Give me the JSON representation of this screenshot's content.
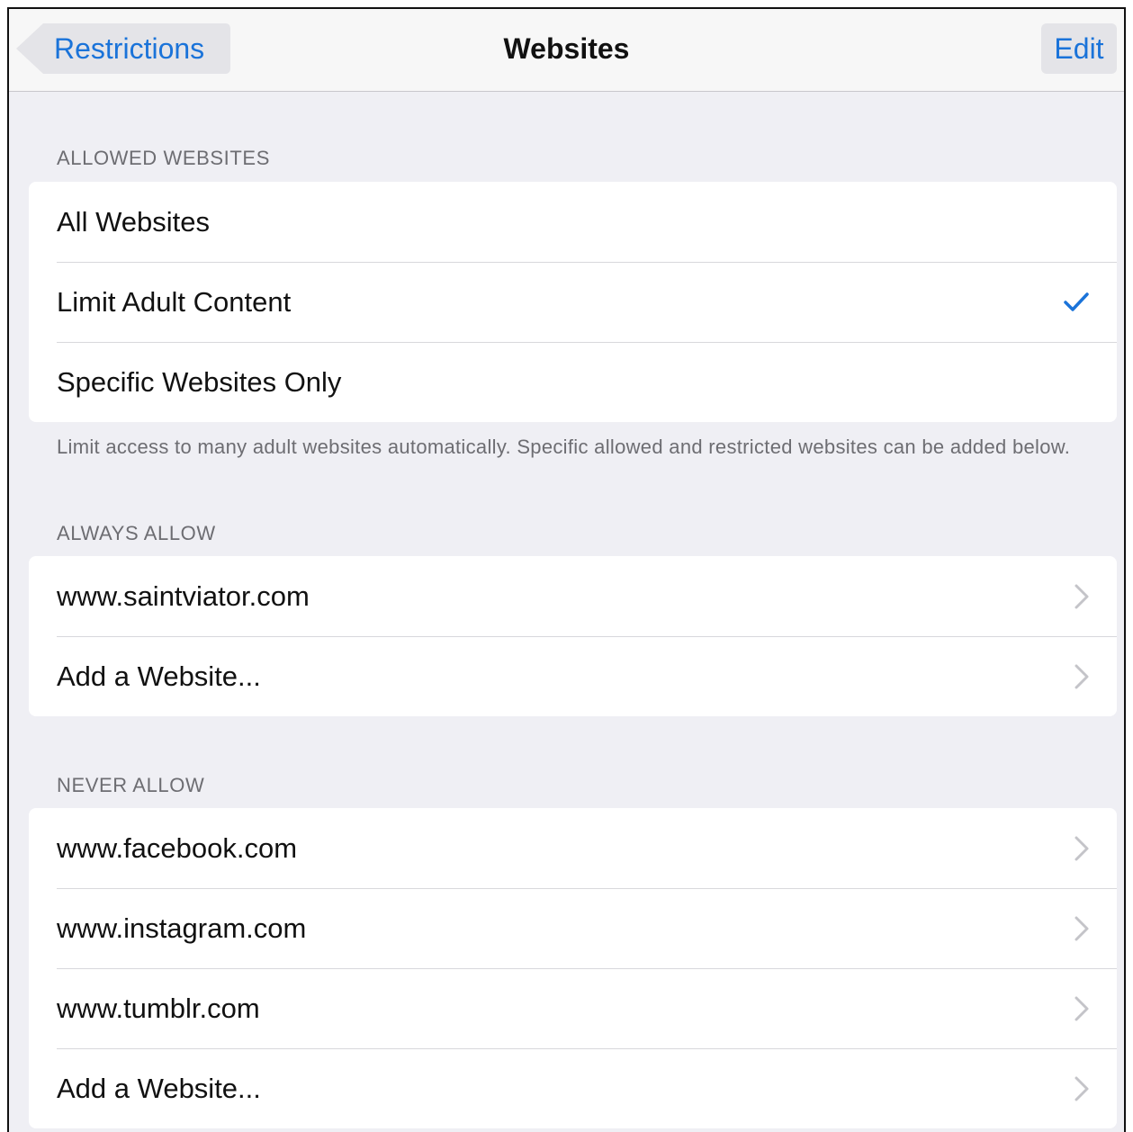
{
  "navbar": {
    "back_label": "Restrictions",
    "title": "Websites",
    "edit_label": "Edit"
  },
  "allowed_websites": {
    "header": "ALLOWED WEBSITES",
    "options": [
      {
        "label": "All Websites",
        "selected": false
      },
      {
        "label": "Limit Adult Content",
        "selected": true
      },
      {
        "label": "Specific Websites Only",
        "selected": false
      }
    ],
    "footer": "Limit access to many adult websites automatically. Specific allowed and restricted websites can be added below."
  },
  "always_allow": {
    "header": "ALWAYS ALLOW",
    "items": [
      {
        "label": "www.saintviator.com"
      },
      {
        "label": "Add a Website..."
      }
    ]
  },
  "never_allow": {
    "header": "NEVER ALLOW",
    "items": [
      {
        "label": "www.facebook.com"
      },
      {
        "label": "www.instagram.com"
      },
      {
        "label": "www.tumblr.com"
      },
      {
        "label": "Add a Website..."
      }
    ]
  },
  "colors": {
    "accent": "#1a73d9",
    "background": "#efeff4",
    "secondary_text": "#6d6d72"
  },
  "icons": {
    "back": "chevron-left-icon",
    "selected": "checkmark-icon",
    "disclosure": "chevron-right-icon"
  }
}
